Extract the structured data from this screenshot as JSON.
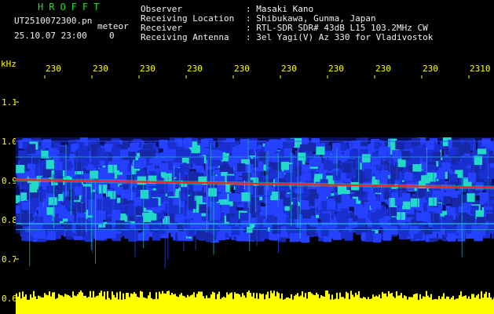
{
  "header": {
    "app_title": "HROFFT",
    "filename": "UT2510072300.pn",
    "tag": "meteor",
    "datetime": "25.10.07 23:00",
    "status": "0",
    "labels": [
      "Observer",
      "Receiving Location",
      "Receiver",
      "Receiving Antenna"
    ],
    "values": [
      ": Masaki Kano",
      ": Shibukawa, Gunma, Japan",
      ": RTL-SDR SDR# 43dB L15 103.2MHz CW",
      ": 3el Yagi(V) Az 330 for Vladivostok"
    ]
  },
  "axis": {
    "y_unit": "kHz",
    "y_ticks": [
      "1.1",
      "1.0",
      "0.9",
      "0.8",
      "0.7",
      "0.6"
    ],
    "x_ticks": [
      "230",
      "230",
      "230",
      "230",
      "230",
      "230",
      "230",
      "230",
      "230",
      "2310"
    ]
  },
  "colors": {
    "background": "#000000",
    "accent_green": "#22dd22",
    "axis_yellow": "#ffff00",
    "signal_red": "#ff2222",
    "noise_blue": "#1a2fd0",
    "noise_cyan": "#22d8c8"
  },
  "signal": {
    "carrier_khz": 0.9
  }
}
